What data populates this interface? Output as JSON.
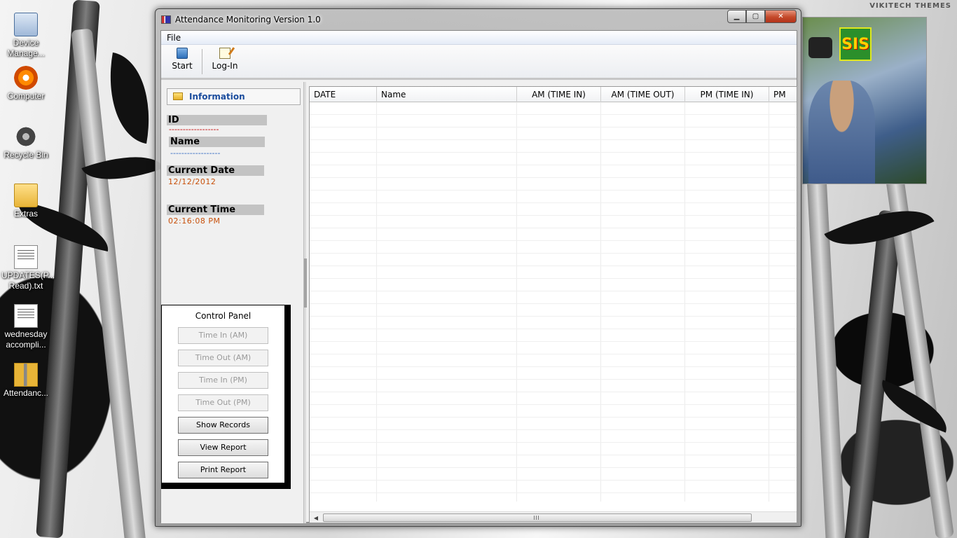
{
  "desktop": {
    "watermark": "VIKITECH THEMES",
    "icons": [
      {
        "label": "Device Manage...",
        "icon": "device-manager-icon"
      },
      {
        "label": "Computer",
        "icon": "computer-icon"
      },
      {
        "label": "Recycle Bin",
        "icon": "recycle-bin-icon"
      },
      {
        "label": "Extras",
        "icon": "folder-icon"
      },
      {
        "label": "UPDATES(P... Read).txt",
        "icon": "text-file-icon"
      },
      {
        "label": "wednesday accompli...",
        "icon": "text-file-icon"
      },
      {
        "label": "Attendanc...",
        "icon": "zip-folder-icon"
      }
    ],
    "gadget": {
      "logo_text": "SIS"
    }
  },
  "window": {
    "title": "Attendance Monitoring Version 1.0",
    "caption_buttons": {
      "minimize": "▁",
      "maximize": "▢",
      "close": "✕"
    },
    "menu": [
      "File"
    ],
    "toolbar": {
      "start_label": "Start",
      "login_label": "Log-In"
    },
    "info_panel": {
      "header": "Information",
      "id_label": "ID",
      "id_value": "------------------",
      "name_label": "Name",
      "name_value": "------------------",
      "date_label": "Current Date",
      "date_value": "12/12/2012",
      "time_label": "Current Time",
      "time_value": "02:16:08 PM"
    },
    "control_panel": {
      "title": "Control Panel",
      "buttons": [
        {
          "label": "Time In (AM)",
          "enabled": false
        },
        {
          "label": "Time Out (AM)",
          "enabled": false
        },
        {
          "label": "Time In (PM)",
          "enabled": false
        },
        {
          "label": "Time Out (PM)",
          "enabled": false
        },
        {
          "label": "Show Records",
          "enabled": true
        },
        {
          "label": "View Report",
          "enabled": true
        },
        {
          "label": "Print Report",
          "enabled": true
        }
      ]
    },
    "grid": {
      "columns": [
        "DATE",
        "Name",
        "AM (TIME IN)",
        "AM (TIME OUT)",
        "PM (TIME IN)",
        "PM"
      ],
      "rows": [],
      "scroll_grip": "III"
    }
  },
  "colors": {
    "info_header_text": "#1a4c9d",
    "id_dash": "#c20000",
    "name_dash": "#3068c0",
    "date_time_value": "#c8500a",
    "close_button": "#c44a2b"
  }
}
